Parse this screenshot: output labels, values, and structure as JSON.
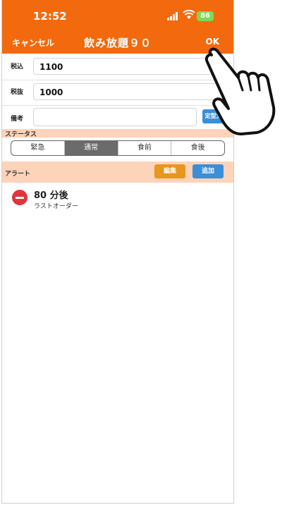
{
  "status_bar": {
    "time": "12:52",
    "battery": "86"
  },
  "nav": {
    "cancel_label": "キャンセル",
    "title": "飲み放題９０",
    "ok_label": "OK"
  },
  "form": {
    "tax_included": {
      "label": "税込",
      "value": "1100"
    },
    "tax_excluded": {
      "label": "税抜",
      "value": "1000"
    },
    "note": {
      "label": "備考",
      "value": "",
      "template_button": "定型文"
    }
  },
  "status_section": {
    "label": "ステータス",
    "options": [
      "緊急",
      "通常",
      "食前",
      "食後"
    ],
    "selected": "通常"
  },
  "alert_section": {
    "label": "アラート",
    "edit_button": "編集",
    "add_button": "追加",
    "items": [
      {
        "time": "80 分後",
        "description": "ラストオーダー"
      }
    ]
  },
  "colors": {
    "accent": "#f26a0d",
    "section_bg": "#fdd3b9",
    "edit": "#e8961e",
    "add": "#3a8fd8",
    "delete": "#e0353c"
  },
  "icons": [
    "signal-icon",
    "wifi-icon",
    "battery-icon",
    "delete-minus-icon",
    "pointing-hand-icon"
  ]
}
